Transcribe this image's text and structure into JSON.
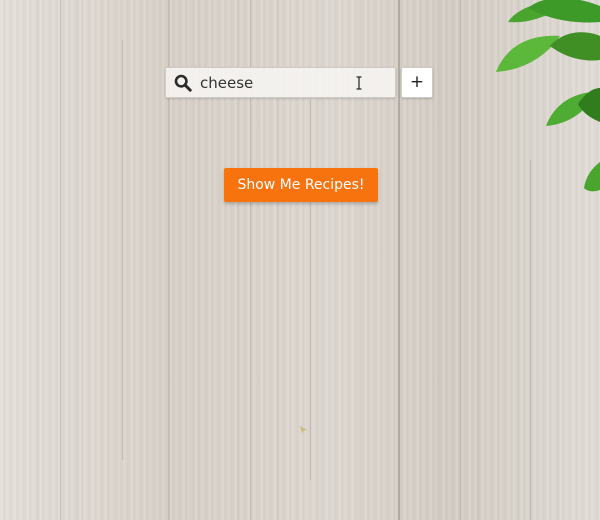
{
  "search": {
    "value": "cheese",
    "icon": "search-icon"
  },
  "add_button": {
    "label": "+"
  },
  "submit_button": {
    "label": "Show Me Recipes!"
  },
  "colors": {
    "accent": "#f7730e",
    "background": "#d9d3cc",
    "leaf": "#3f9b2c"
  }
}
